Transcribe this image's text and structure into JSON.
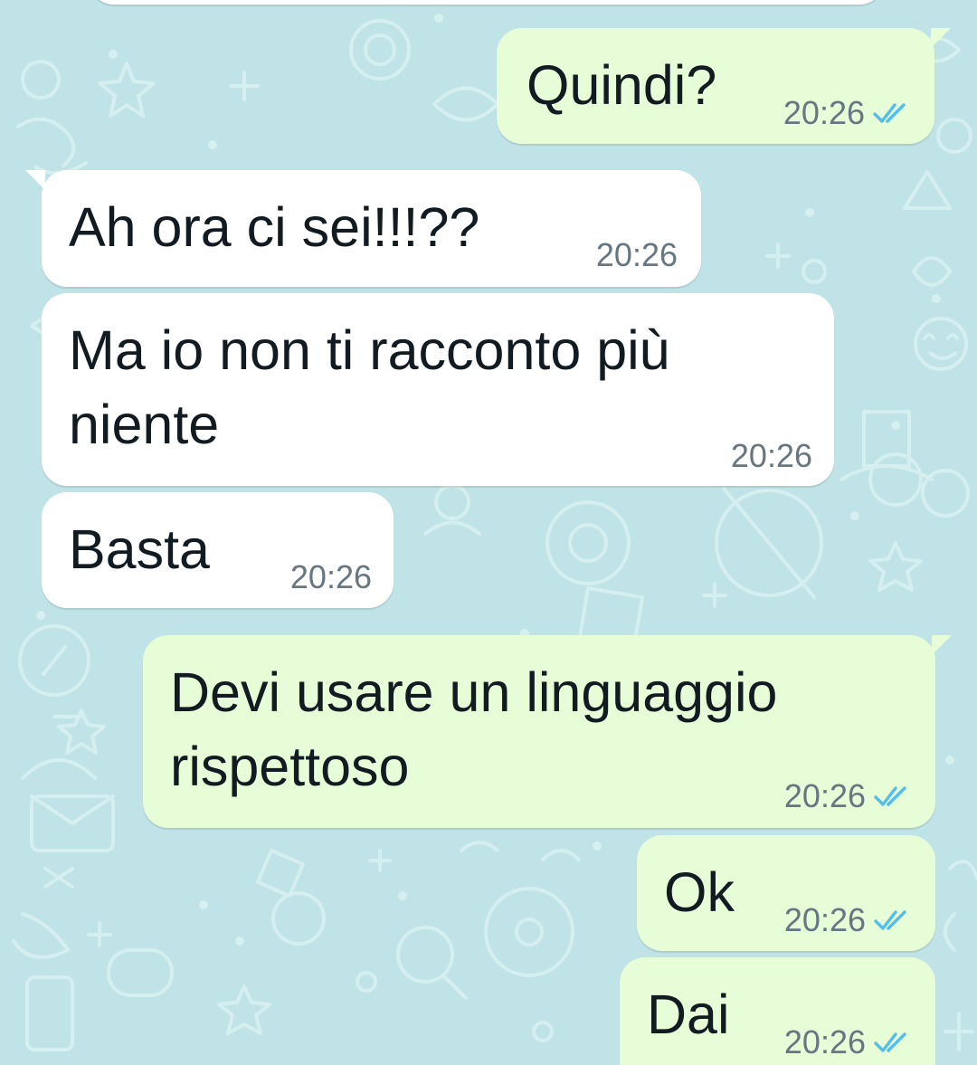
{
  "colors": {
    "wallpaper": "#bfe3e6",
    "incoming_bubble": "#ffffff",
    "outgoing_bubble": "#e7fdd8",
    "text": "#111b21",
    "timestamp": "#667781",
    "read_ticks": "#53bdeb"
  },
  "messages": [
    {
      "direction": "outgoing",
      "text": "Quindi?",
      "time": "20:26",
      "status": "read"
    },
    {
      "direction": "incoming",
      "text": "Ah ora ci sei!!!??",
      "time": "20:26"
    },
    {
      "direction": "incoming",
      "text": "Ma io non ti racconto più\nniente",
      "time": "20:26"
    },
    {
      "direction": "incoming",
      "text": "Basta",
      "time": "20:26"
    },
    {
      "direction": "outgoing",
      "text": "Devi usare un linguaggio\nrispettoso",
      "time": "20:26",
      "status": "read"
    },
    {
      "direction": "outgoing",
      "text": "Ok",
      "time": "20:26",
      "status": "read"
    },
    {
      "direction": "outgoing",
      "text": "Dai",
      "time": "20:26",
      "status": "read"
    }
  ],
  "icons": {
    "read_receipt": "double-check-icon"
  }
}
